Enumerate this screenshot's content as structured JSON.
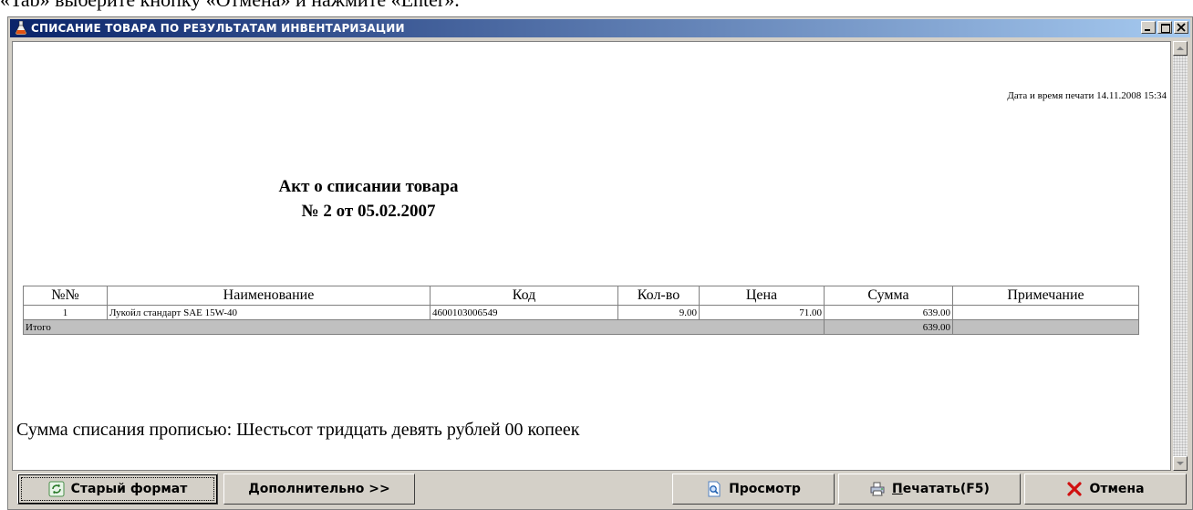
{
  "top_caption": "«Tab» выберите кнопку «Отмена» и нажмите «Enter».",
  "window": {
    "title": "СПИСАНИЕ ТОВАРА ПО РЕЗУЛЬТАТАМ ИНВЕНТАРИЗАЦИИ"
  },
  "document": {
    "print_datetime": "Дата и время печати 14.11.2008 15:34",
    "title": "Акт о списании товара",
    "subtitle": "№ 2 от 05.02.2007",
    "table": {
      "headers": [
        "№№",
        "Наименование",
        "Код",
        "Кол-во",
        "Цена",
        "Сумма",
        "Примечание"
      ],
      "rows": [
        [
          "1",
          "Лукойл стандарт SAE 15W-40",
          "4600103006549",
          "9.00",
          "71.00",
          "639.00",
          ""
        ]
      ],
      "total": {
        "label": "Итого",
        "amount": "639.00"
      }
    },
    "sum_in_words": "Сумма списания прописью: Шестьсот тридцать девять рублей 00 копеек"
  },
  "buttons": {
    "old_format": "Старый формат",
    "additional": "Дополнительно >>",
    "preview": "Просмотр",
    "print_first": "П",
    "print_rest": "ечатать(F5)",
    "cancel": "Отмена"
  },
  "icons": {
    "window": "flask-icon",
    "old_format": "refresh-icon",
    "preview": "magnifier-document-icon",
    "print": "printer-icon",
    "cancel": "red-x-icon"
  }
}
